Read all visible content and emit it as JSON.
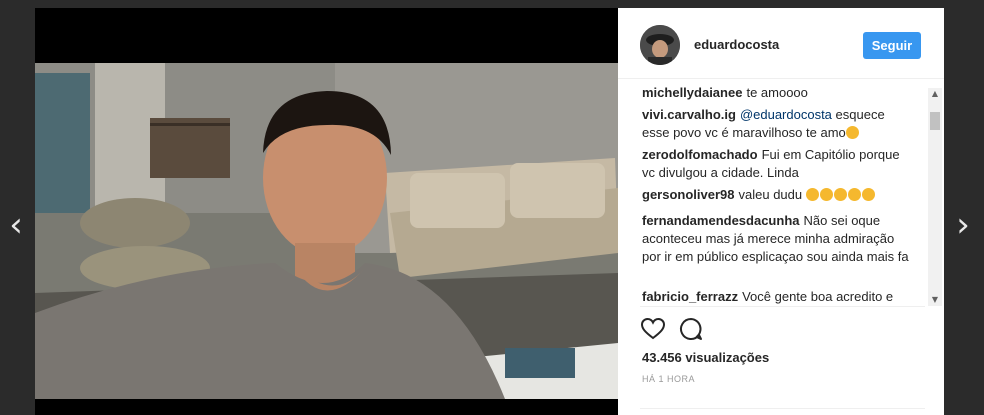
{
  "navigation": {
    "prev_icon": "chevron-left-icon",
    "next_icon": "chevron-right-icon"
  },
  "post": {
    "username": "eduardocosta",
    "follow_label": "Seguir",
    "views": "43.456 visualizações",
    "time": "HÁ 1 HORA"
  },
  "comments": [
    {
      "user": "michellydaianee",
      "text": "te amoooo"
    },
    {
      "user": "vivi.carvalho.ig",
      "mention": "@eduardocosta",
      "text": " esquece esse povo vc é maravilhoso te amo"
    },
    {
      "user": "zerodolfomachado",
      "text": "Fui em Capitólio porque vc divulgou a cidade. Linda"
    },
    {
      "user": "gersonoliver98",
      "text": "valeu dudu"
    },
    {
      "user": "fernandamendesdacunha",
      "text": "Não sei oque aconteceu mas já merece minha admiração por ir em público esplicaçao sou ainda mais fa"
    },
    {
      "user": "fabricio_ferrazz",
      "text": "Você gente boa acredito e"
    }
  ],
  "colors": {
    "accent": "#3897f0",
    "text": "#262626",
    "muted": "#999999"
  }
}
